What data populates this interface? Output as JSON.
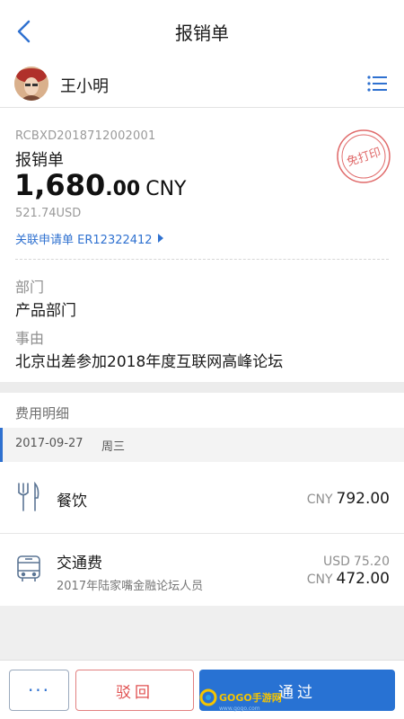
{
  "nav": {
    "title": "报销单"
  },
  "user": {
    "name": "王小明"
  },
  "summary": {
    "doc_no": "RCBXD2018712002001",
    "doc_type": "报销单",
    "amount_int": "1,680",
    "amount_dec": ".00",
    "currency": "CNY",
    "usd": "521.74USD",
    "link_label": "关联申请单",
    "link_no": "ER12322412",
    "stamp_text": "免打印"
  },
  "info": {
    "dept_label": "部门",
    "dept_value": "产品部门",
    "reason_label": "事由",
    "reason_value": "北京出差参加2018年度互联网高峰论坛"
  },
  "details": {
    "title": "费用明细",
    "date": "2017-09-27",
    "weekday": "周三",
    "items": [
      {
        "name": "餐饮",
        "currency": "CNY",
        "amount": "792.00",
        "icon": "fork-knife-icon"
      },
      {
        "name": "交通费",
        "desc": "2017年陆家嘴金融论坛人员",
        "orig_currency": "USD",
        "orig_amount": "75.20",
        "currency": "CNY",
        "amount": "472.00",
        "icon": "bus-icon"
      }
    ]
  },
  "footer": {
    "more_label": "···",
    "reject_label": "驳回",
    "pass_label": "通过"
  },
  "watermark": {
    "text": "GOGO手游网",
    "sub": "www.gogo.com"
  },
  "colors": {
    "accent": "#2f71d0",
    "reject": "#e05050",
    "stamp": "#e06a6a"
  }
}
